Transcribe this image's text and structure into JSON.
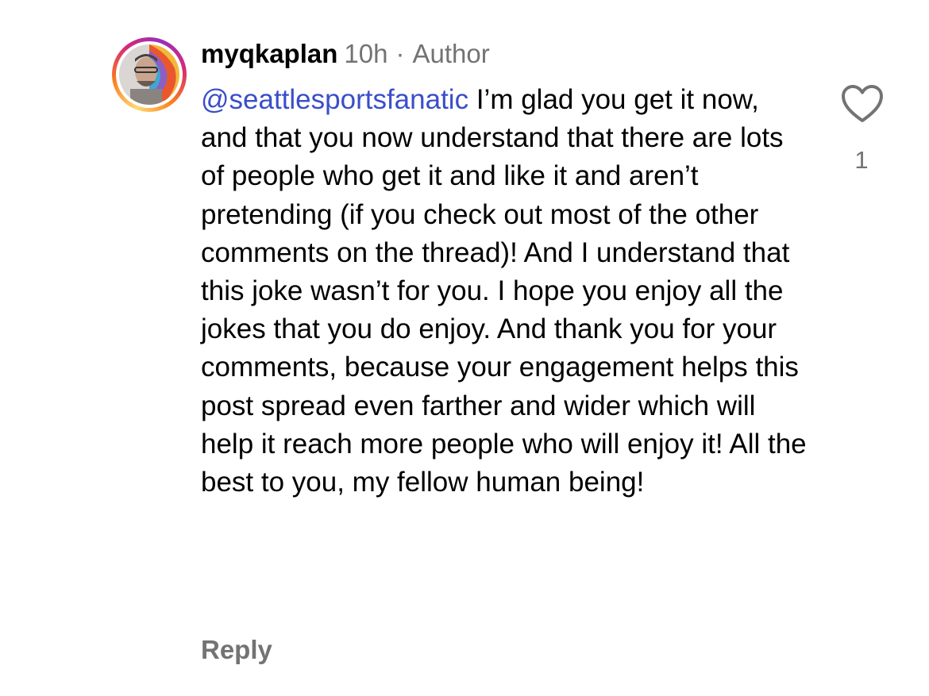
{
  "comment": {
    "username": "myqkaplan",
    "time": "10h",
    "separator": "·",
    "role_badge": "Author",
    "mention": "@seattlesportsfanatic",
    "text": " I’m glad you get it now, and that you now understand that there are lots of people who get it and like it and aren’t pretending (if you check out most of the other comments on the thread)! And I understand that this joke wasn’t for you. I hope you enjoy all the jokes that you do enjoy. And thank you for your comments, because your engagement helps this post spread even farther and wider which will help it reach more people who will enjoy it! All the best to you, my fellow human being!",
    "reply_label": "Reply",
    "like_count": "1",
    "like_icon": "heart-outline-icon"
  },
  "colors": {
    "mention": "#3a4ec9",
    "meta": "#737373",
    "text": "#000000"
  }
}
